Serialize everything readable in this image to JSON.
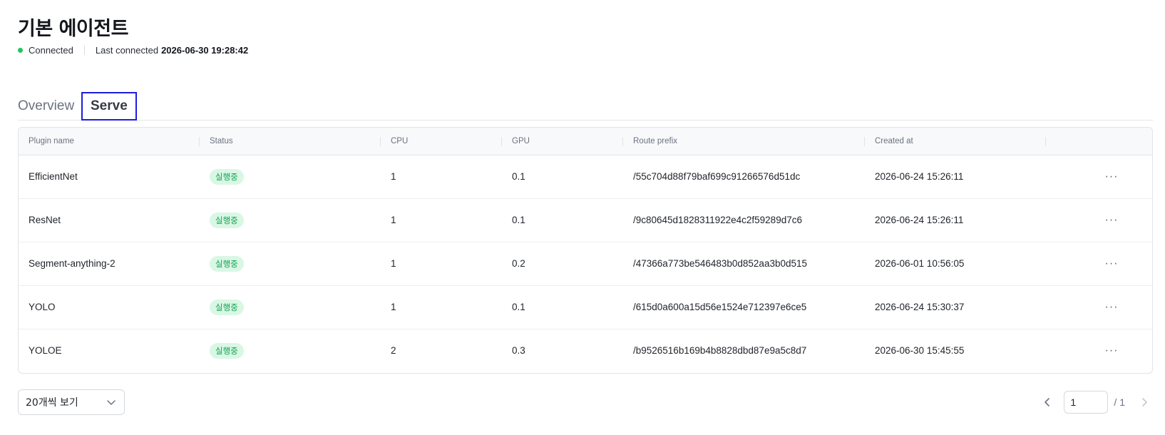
{
  "header": {
    "title": "기본 에이전트",
    "status": "Connected",
    "last_connected_label": "Last connected",
    "last_connected_time": "2026-06-30 19:28:42"
  },
  "tabs": [
    {
      "label": "Overview",
      "active": false
    },
    {
      "label": "Serve",
      "active": true
    }
  ],
  "table": {
    "columns": [
      "Plugin name",
      "Status",
      "CPU",
      "GPU",
      "Route prefix",
      "Created at",
      ""
    ],
    "rows": [
      {
        "name": "EfficientNet",
        "status": "실행중",
        "cpu": "1",
        "gpu": "0.1",
        "route": "/55c704d88f79baf699c91266576d51dc",
        "created": "2026-06-24 15:26:11"
      },
      {
        "name": "ResNet",
        "status": "실행중",
        "cpu": "1",
        "gpu": "0.1",
        "route": "/9c80645d1828311922e4c2f59289d7c6",
        "created": "2026-06-24 15:26:11"
      },
      {
        "name": "Segment-anything-2",
        "status": "실행중",
        "cpu": "1",
        "gpu": "0.2",
        "route": "/47366a773be546483b0d852aa3b0d515",
        "created": "2026-06-01 10:56:05"
      },
      {
        "name": "YOLO",
        "status": "실행중",
        "cpu": "1",
        "gpu": "0.1",
        "route": "/615d0a600a15d56e1524e712397e6ce5",
        "created": "2026-06-24 15:30:37"
      },
      {
        "name": "YOLOE",
        "status": "실행중",
        "cpu": "2",
        "gpu": "0.3",
        "route": "/b9526516b169b4b8828dbd87e9a5c8d7",
        "created": "2026-06-30 15:45:55"
      }
    ],
    "row_action_icon": "more-horizontal-icon"
  },
  "footer": {
    "page_size_label": "20개씩 보기",
    "current_page": "1",
    "total_pages": "/ 1"
  },
  "colors": {
    "connected": "#22c55e",
    "badge_bg": "#d9f7e5",
    "badge_text": "#12a150",
    "active_tab_border": "#1d1de0"
  }
}
